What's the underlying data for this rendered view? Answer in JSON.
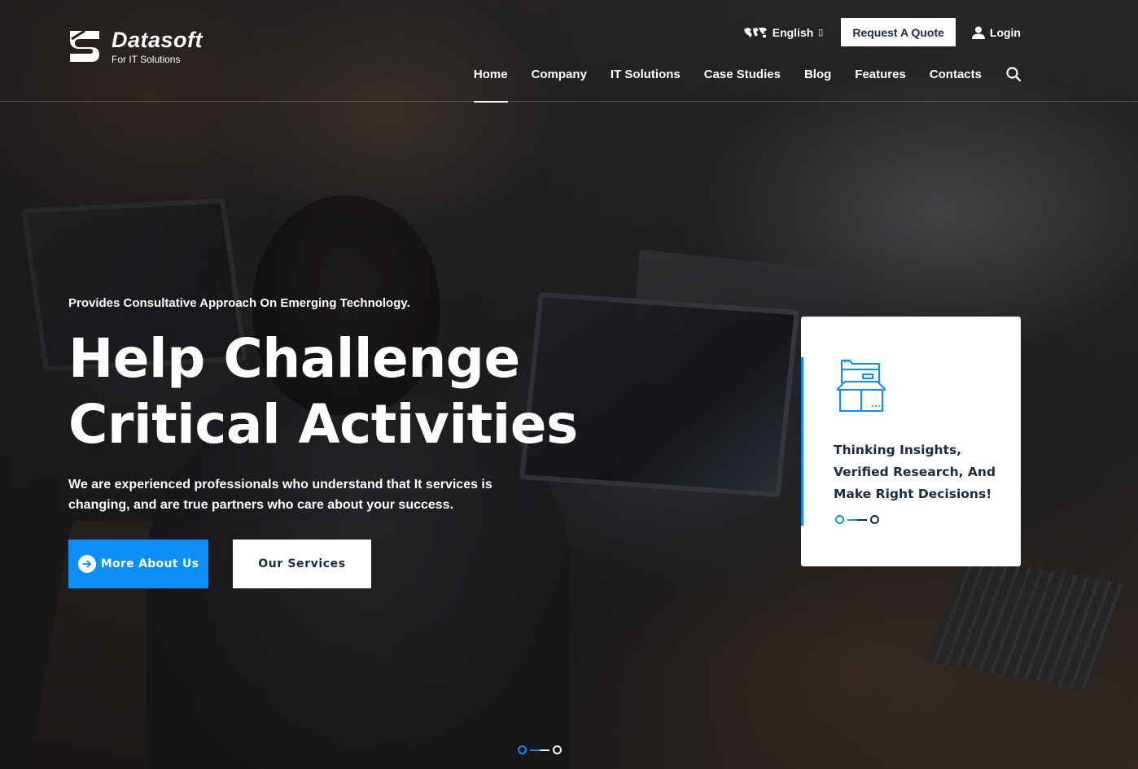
{
  "brand": {
    "name": "Datasoft",
    "tagline": "For IT Solutions"
  },
  "topbar": {
    "language": "English",
    "language_caret": "▯",
    "quote_button": "Request A Quote",
    "login": "Login"
  },
  "nav": {
    "items": [
      {
        "label": "Home",
        "active": true
      },
      {
        "label": "Company",
        "active": false
      },
      {
        "label": "IT Solutions",
        "active": false
      },
      {
        "label": "Case Studies",
        "active": false
      },
      {
        "label": "Blog",
        "active": false
      },
      {
        "label": "Features",
        "active": false
      },
      {
        "label": "Contacts",
        "active": false
      }
    ],
    "search_icon": "search-icon"
  },
  "hero": {
    "eyebrow": "Provides Consultative Approach On Emerging Technology.",
    "headline_line1": "Help Challenge",
    "headline_line2": "Critical Activities",
    "subtext": "We are experienced professionals who understand that It services is changing, and are true partners who care about your success.",
    "primary_button": "More About Us",
    "secondary_button": "Our Services"
  },
  "card": {
    "icon": "folder-box-icon",
    "line1": "Thinking Insights,",
    "line2": "Verified Research, And",
    "line3": "Make Right Decisions!"
  },
  "colors": {
    "accent": "#0d8ef5",
    "navy": "#1b2b44",
    "white": "#ffffff"
  }
}
